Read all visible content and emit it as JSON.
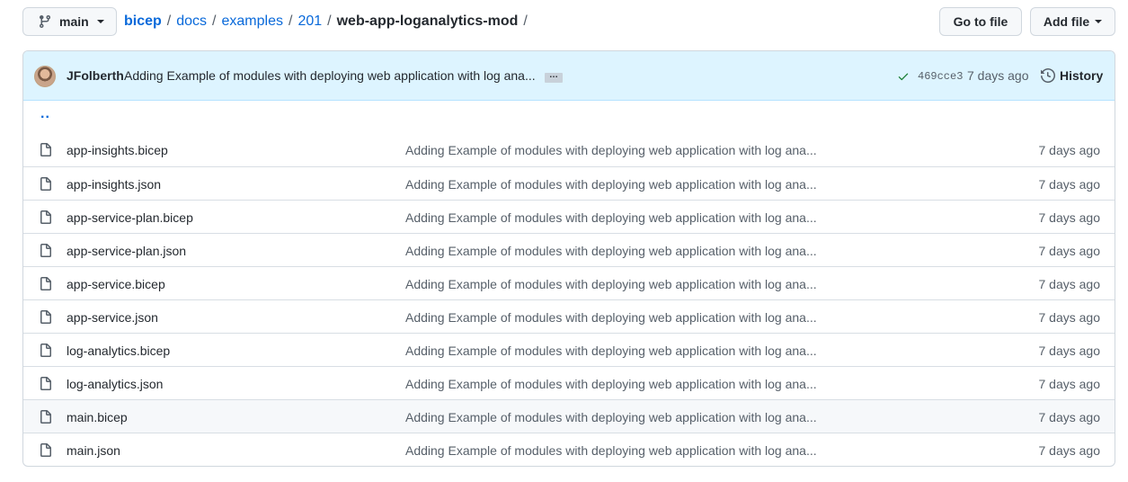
{
  "branch": {
    "name": "main",
    "icon": "git-branch-icon"
  },
  "breadcrumb": {
    "items": [
      "bicep",
      "docs",
      "examples",
      "201"
    ],
    "current": "web-app-loganalytics-mod",
    "separator": "/"
  },
  "actions": {
    "go_to_file": "Go to file",
    "add_file": "Add file"
  },
  "commit": {
    "author": "JFolberth",
    "message": "Adding Example of modules with deploying web application with log ana...",
    "ellipsis": "…",
    "sha": "469cce3",
    "time": "7 days ago",
    "history_label": "History",
    "status_color": "#1a7f37"
  },
  "parent_dir": "..",
  "files": [
    {
      "name": "app-insights.bicep",
      "message": "Adding Example of modules with deploying web application with log ana...",
      "age": "7 days ago"
    },
    {
      "name": "app-insights.json",
      "message": "Adding Example of modules with deploying web application with log ana...",
      "age": "7 days ago"
    },
    {
      "name": "app-service-plan.bicep",
      "message": "Adding Example of modules with deploying web application with log ana...",
      "age": "7 days ago"
    },
    {
      "name": "app-service-plan.json",
      "message": "Adding Example of modules with deploying web application with log ana...",
      "age": "7 days ago"
    },
    {
      "name": "app-service.bicep",
      "message": "Adding Example of modules with deploying web application with log ana...",
      "age": "7 days ago"
    },
    {
      "name": "app-service.json",
      "message": "Adding Example of modules with deploying web application with log ana...",
      "age": "7 days ago"
    },
    {
      "name": "log-analytics.bicep",
      "message": "Adding Example of modules with deploying web application with log ana...",
      "age": "7 days ago"
    },
    {
      "name": "log-analytics.json",
      "message": "Adding Example of modules with deploying web application with log ana...",
      "age": "7 days ago"
    },
    {
      "name": "main.bicep",
      "message": "Adding Example of modules with deploying web application with log ana...",
      "age": "7 days ago"
    },
    {
      "name": "main.json",
      "message": "Adding Example of modules with deploying web application with log ana...",
      "age": "7 days ago"
    }
  ],
  "colors": {
    "link": "#0969da",
    "commit_bar_bg": "#ddf4ff",
    "hover_row_bg": "#f6f8fa"
  }
}
